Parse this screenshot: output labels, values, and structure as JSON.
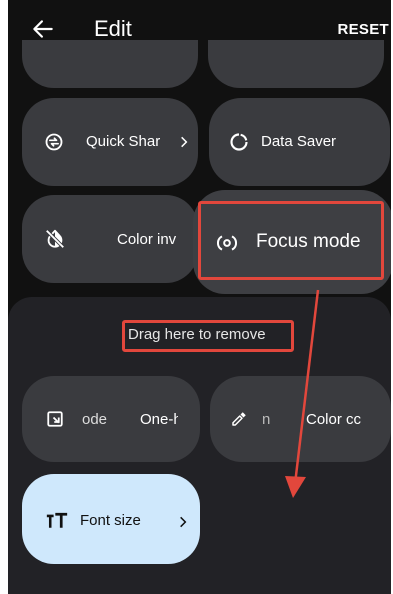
{
  "topbar": {
    "title": "Edit",
    "reset_label": "RESET"
  },
  "tiles": {
    "quick_share": {
      "label": "Quick Shar",
      "icon": "quick-share-icon"
    },
    "data_saver": {
      "label": "Data Saver",
      "icon": "data-saver-icon"
    },
    "color_inversion": {
      "label": "Color inv",
      "icon": "invert-colors-off-icon"
    },
    "focus_mode": {
      "label": "Focus mode",
      "icon": "focus-mode-icon"
    }
  },
  "remove_area": {
    "instruction": "Drag here to remove",
    "tiles": {
      "one_handed": {
        "label_left": "ode",
        "label_right": "One-h",
        "icon": "one-handed-mode-icon"
      },
      "color_correction": {
        "label_left": "n",
        "label_right": "Color cc",
        "icon": "eyedropper-icon"
      },
      "font_size": {
        "label": "Font size",
        "icon": "font-size-icon"
      }
    }
  },
  "colors": {
    "background": "#111111",
    "tile": "#3a3b3f",
    "remove_area": "#222226",
    "font_size_tile": "#cfe8fc",
    "annotation_red": "#e2473c"
  }
}
